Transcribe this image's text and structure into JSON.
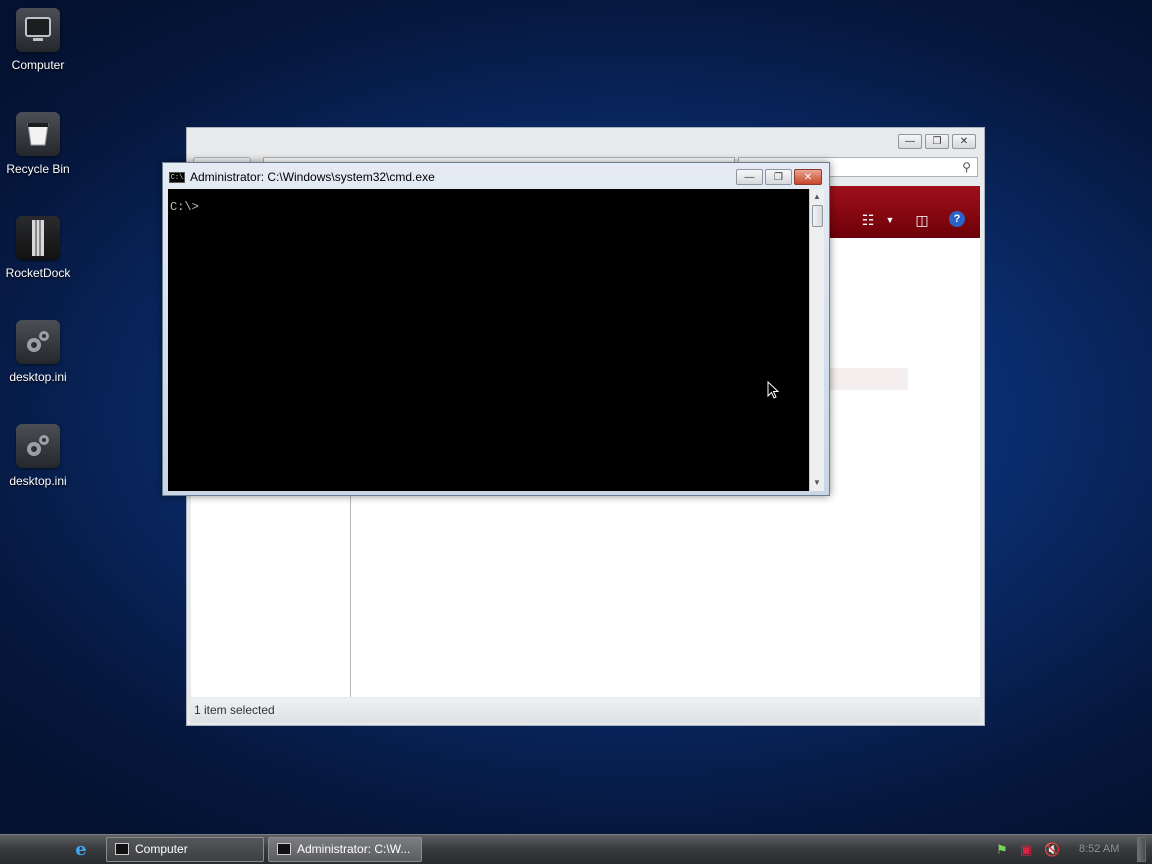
{
  "desktop": {
    "icons": [
      {
        "label": "Computer",
        "icon": "computer-icon"
      },
      {
        "label": "Recycle Bin",
        "icon": "recycle-bin-icon"
      },
      {
        "label": "RocketDock",
        "icon": "rocketdock-icon"
      },
      {
        "label": "desktop.ini",
        "icon": "settings-file-icon"
      },
      {
        "label": "desktop.ini",
        "icon": "settings-file-icon"
      }
    ]
  },
  "explorer": {
    "status_text": "1 item selected",
    "toolbar_color": "#8b0a12",
    "toolbar_icons": [
      "view-options-icon",
      "preview-pane-icon",
      "help-icon"
    ]
  },
  "cmd": {
    "title": "Administrator: C:\\Windows\\system32\\cmd.exe",
    "prompt": "C:\\>",
    "app_icon_text": "C:\\"
  },
  "taskbar": {
    "buttons": [
      {
        "label": "Computer",
        "active": false
      },
      {
        "label": "Administrator: C:\\W...",
        "active": true
      }
    ],
    "tray_icons": [
      "action-center-icon",
      "network-icon",
      "volume-muted-icon"
    ],
    "clock": "8:52 AM"
  }
}
